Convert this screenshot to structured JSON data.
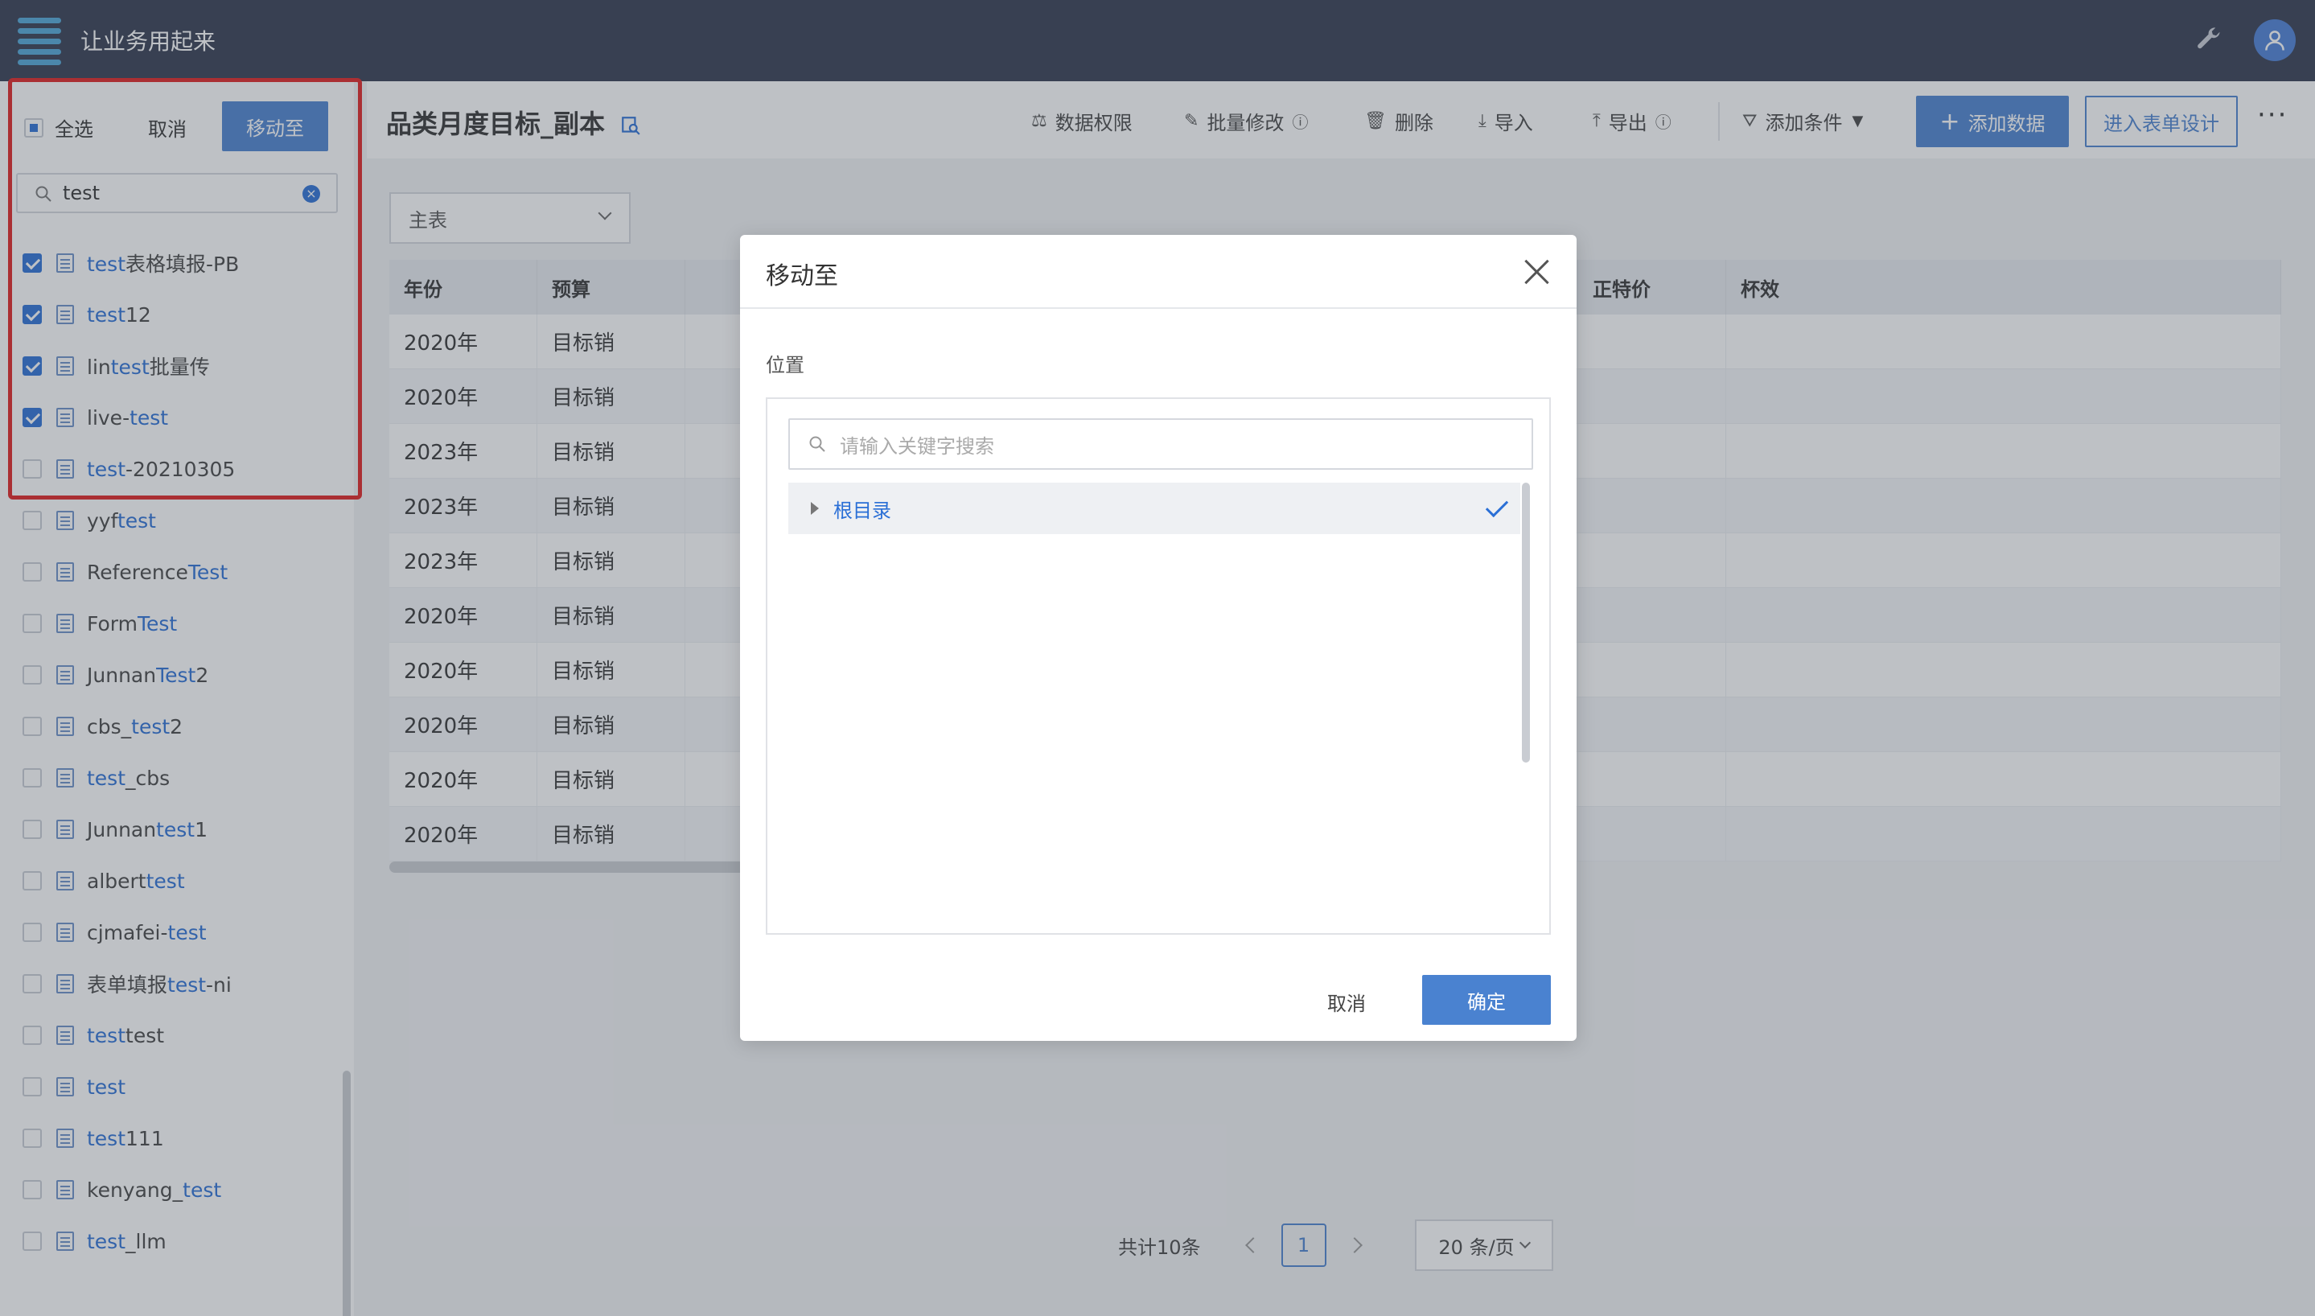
{
  "app": {
    "title": "让业务用起来"
  },
  "sidebar": {
    "select_all": "全选",
    "cancel": "取消",
    "move_to": "移动至",
    "search_value": "test",
    "items": [
      {
        "pre": "",
        "hl": "test",
        "post": "表格填报-PB",
        "checked": true
      },
      {
        "pre": "",
        "hl": "test",
        "post": "12",
        "checked": true
      },
      {
        "pre": "lin",
        "hl": "test",
        "post": "批量传",
        "checked": true
      },
      {
        "pre": "live-",
        "hl": "test",
        "post": "",
        "checked": true
      },
      {
        "pre": "",
        "hl": "test",
        "post": "-20210305",
        "checked": false
      },
      {
        "pre": "yyf",
        "hl": "test",
        "post": "",
        "checked": false
      },
      {
        "pre": "Reference",
        "hl": "Test",
        "post": "",
        "checked": false
      },
      {
        "pre": "Form",
        "hl": "Test",
        "post": "",
        "checked": false
      },
      {
        "pre": "Junnan",
        "hl": "Test",
        "post": "2",
        "checked": false
      },
      {
        "pre": "cbs_",
        "hl": "test",
        "post": "2",
        "checked": false
      },
      {
        "pre": "",
        "hl": "test",
        "post": "_cbs",
        "checked": false
      },
      {
        "pre": "Junnan",
        "hl": "test",
        "post": "1",
        "checked": false
      },
      {
        "pre": "albert",
        "hl": "test",
        "post": "",
        "checked": false
      },
      {
        "pre": "cjmafei-",
        "hl": "test",
        "post": "",
        "checked": false
      },
      {
        "pre": "表单填报",
        "hl": "test",
        "post": "-ni",
        "checked": false
      },
      {
        "pre": "",
        "hl": "test",
        "post": "test",
        "checked": false
      },
      {
        "pre": "",
        "hl": "test",
        "post": "",
        "checked": false
      },
      {
        "pre": "",
        "hl": "test",
        "post": "111",
        "checked": false
      },
      {
        "pre": "kenyang_",
        "hl": "test",
        "post": "",
        "checked": false
      },
      {
        "pre": "",
        "hl": "test",
        "post": "_llm",
        "checked": false
      }
    ]
  },
  "header": {
    "page_title": "品类月度目标_副本",
    "toolbar": {
      "data_permission": "数据权限",
      "batch_edit": "批量修改",
      "delete": "删除",
      "import": "导入",
      "export": "导出",
      "add_condition": "添加条件",
      "add_data": "添加数据",
      "enter_design": "进入表单设计"
    }
  },
  "table": {
    "table_select": "主表",
    "columns": [
      "年份",
      "预算",
      "",
      "",
      "",
      "正特价",
      "杯效"
    ],
    "rows": [
      [
        "2020年",
        "目标销",
        "",
        "",
        "",
        "",
        ""
      ],
      [
        "2020年",
        "目标销",
        "",
        "",
        "",
        "",
        ""
      ],
      [
        "2023年",
        "目标销",
        "",
        "",
        "",
        "",
        ""
      ],
      [
        "2023年",
        "目标销",
        "",
        "",
        "",
        "",
        ""
      ],
      [
        "2023年",
        "目标销",
        "",
        "",
        "",
        "",
        ""
      ],
      [
        "2020年",
        "目标销",
        "",
        "",
        "",
        "",
        ""
      ],
      [
        "2020年",
        "目标销",
        "",
        "",
        "",
        "",
        ""
      ],
      [
        "2020年",
        "目标销",
        "",
        "",
        "",
        "",
        ""
      ],
      [
        "2020年",
        "目标销",
        "",
        "",
        "",
        "",
        ""
      ],
      [
        "2020年",
        "目标销",
        "",
        "",
        "",
        "",
        ""
      ]
    ]
  },
  "pagination": {
    "total": "共计10条",
    "current": "1",
    "page_size": "20 条/页"
  },
  "modal": {
    "title": "移动至",
    "position_label": "位置",
    "search_placeholder": "请输入关键字搜索",
    "root_node": "根目录",
    "cancel": "取消",
    "confirm": "确定"
  },
  "colors": {
    "topbar": "#323a4f",
    "primary": "#4a82d0",
    "highlight": "#2a6fd6",
    "annotation_box": "#e0201f"
  }
}
